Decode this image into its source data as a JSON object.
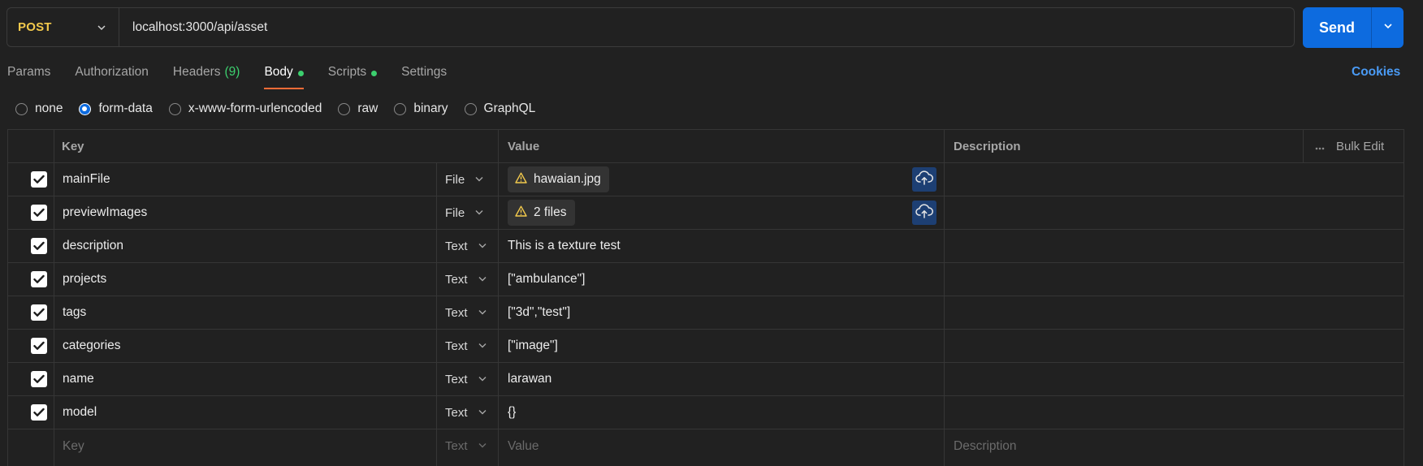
{
  "request": {
    "method": "POST",
    "url": "localhost:3000/api/asset",
    "send_label": "Send"
  },
  "tabs": [
    {
      "label": "Params"
    },
    {
      "label": "Authorization"
    },
    {
      "label": "Headers",
      "count": "(9)"
    },
    {
      "label": "Body",
      "active": true,
      "dot": true
    },
    {
      "label": "Scripts",
      "dot": true
    },
    {
      "label": "Settings"
    }
  ],
  "cookies_label": "Cookies",
  "body_types": [
    {
      "label": "none",
      "selected": false
    },
    {
      "label": "form-data",
      "selected": true
    },
    {
      "label": "x-www-form-urlencoded",
      "selected": false
    },
    {
      "label": "raw",
      "selected": false
    },
    {
      "label": "binary",
      "selected": false
    },
    {
      "label": "GraphQL",
      "selected": false
    }
  ],
  "table": {
    "headers": {
      "key": "Key",
      "value": "Value",
      "description": "Description",
      "bulk_edit": "Bulk Edit"
    },
    "rows": [
      {
        "key": "mainFile",
        "type": "File",
        "value": "hawaian.jpg",
        "is_file": true
      },
      {
        "key": "previewImages",
        "type": "File",
        "value": "2 files",
        "is_file": true
      },
      {
        "key": "description",
        "type": "Text",
        "value": "This is a texture test"
      },
      {
        "key": "projects",
        "type": "Text",
        "value": "[\"ambulance\"]"
      },
      {
        "key": "tags",
        "type": "Text",
        "value": "[\"3d\",\"test\"]"
      },
      {
        "key": "categories",
        "type": "Text",
        "value": "[\"image\"]"
      },
      {
        "key": "name",
        "type": "Text",
        "value": "larawan"
      },
      {
        "key": "model",
        "type": "Text",
        "value": "{}"
      }
    ],
    "new_row": {
      "key": "Key",
      "type": "Text",
      "value": "Value",
      "description": "Description"
    }
  },
  "colors": {
    "background": "#212121",
    "method": "#f2c94c",
    "send": "#0d6bdf",
    "active_tab_underline": "#ff6c37",
    "green_indicator": "#3ccf6e",
    "link": "#4a9bf5"
  }
}
